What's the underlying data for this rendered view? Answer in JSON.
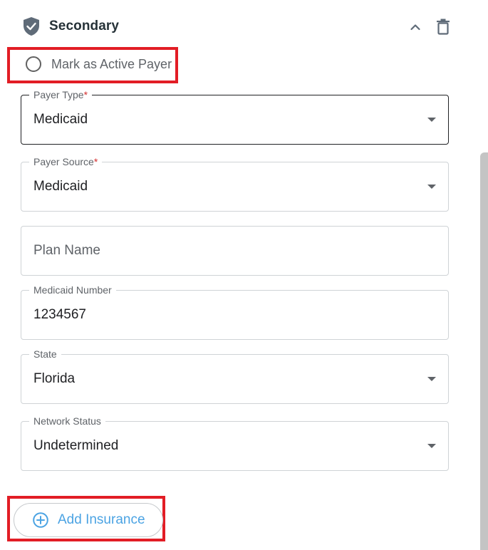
{
  "header": {
    "title": "Secondary",
    "icons": {
      "status": "shield-check-icon",
      "collapse": "chevron-up-icon",
      "delete": "trash-icon"
    }
  },
  "active_payer": {
    "label": "Mark as Active Payer",
    "checked": false
  },
  "fields": {
    "payer_type": {
      "label": "Payer Type",
      "required": "*",
      "value": "Medicaid"
    },
    "payer_source": {
      "label": "Payer Source",
      "required": "*",
      "value": "Medicaid"
    },
    "plan_name": {
      "placeholder": "Plan Name",
      "value": ""
    },
    "medicaid_number": {
      "label": "Medicaid Number",
      "value": "1234567"
    },
    "state": {
      "label": "State",
      "value": "Florida"
    },
    "network_status": {
      "label": "Network Status",
      "value": "Undetermined"
    }
  },
  "add_insurance": {
    "label": "Add Insurance",
    "icon": "plus-circle-icon"
  },
  "colors": {
    "highlight": "#e21d25",
    "accent": "#4ba3e3",
    "required": "#d32f2f",
    "icon": "#5f6b78"
  }
}
